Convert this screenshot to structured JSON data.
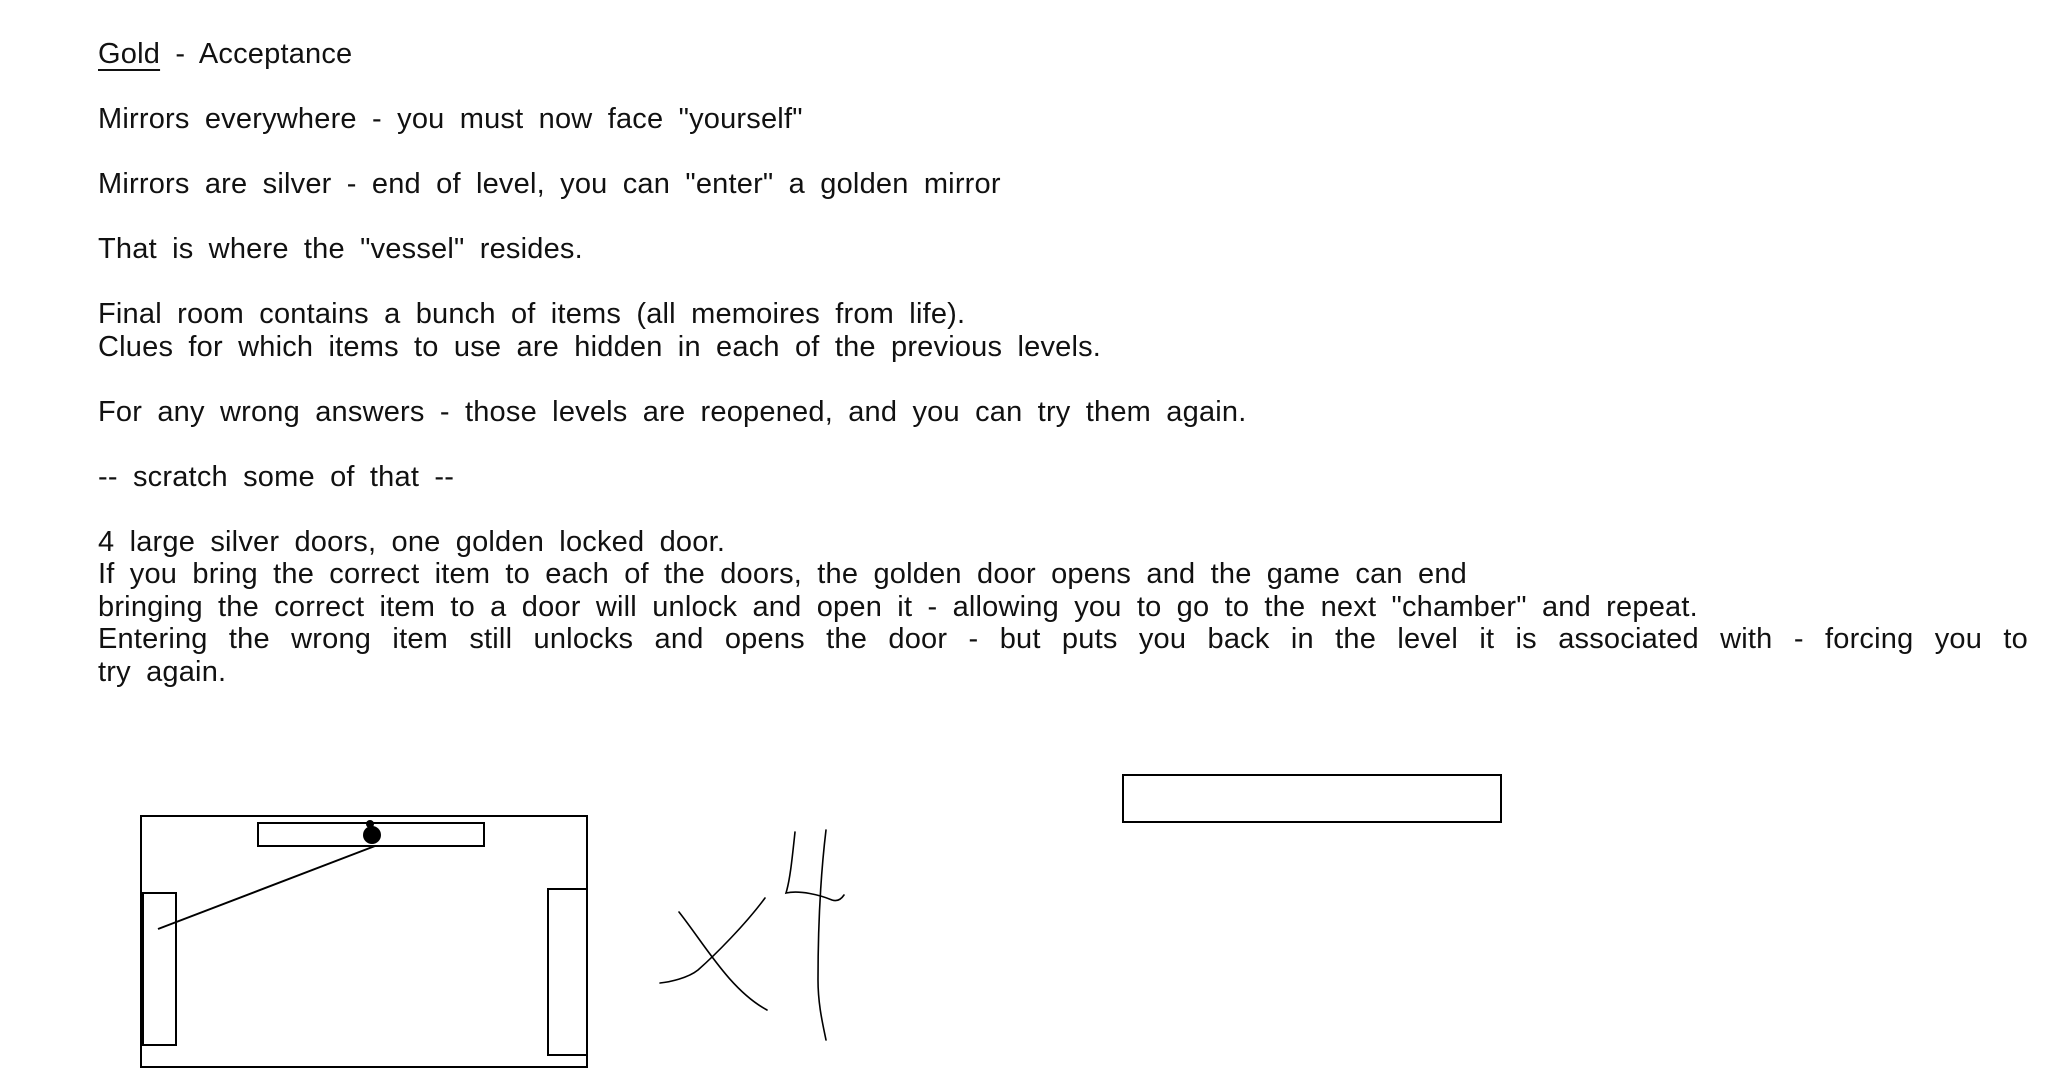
{
  "heading": {
    "gold": "Gold",
    "separator": " - ",
    "title": "Acceptance"
  },
  "paragraphs": {
    "p1": "Mirrors everywhere - you must now face \"yourself\"",
    "p2": "Mirrors are silver - end of level, you can \"enter\" a golden mirror",
    "p3": "That is where the \"vessel\" resides.",
    "p4_line1": "Final room contains a bunch of items (all memoires from life).",
    "p4_line2": "Clues for which items to use are hidden in each of the previous levels.",
    "p5": "For any wrong answers - those levels are reopened, and you can try them again.",
    "p6": "-- scratch some of that --",
    "p7_line1": "4 large silver doors, one golden locked door.",
    "p7_line2": "If you bring the correct item to each of the doors, the golden door opens and the game can end",
    "p7_line3": "bringing the correct item to a door will unlock and open it - allowing you to go to the next \"chamber\" and repeat.",
    "p7_line4": "Entering the wrong item still unlocks and opens the door - but puts you back in the level it is associated with - forcing you to",
    "p7_line5": "try again."
  },
  "sketch": {
    "multiplier": "x4"
  }
}
